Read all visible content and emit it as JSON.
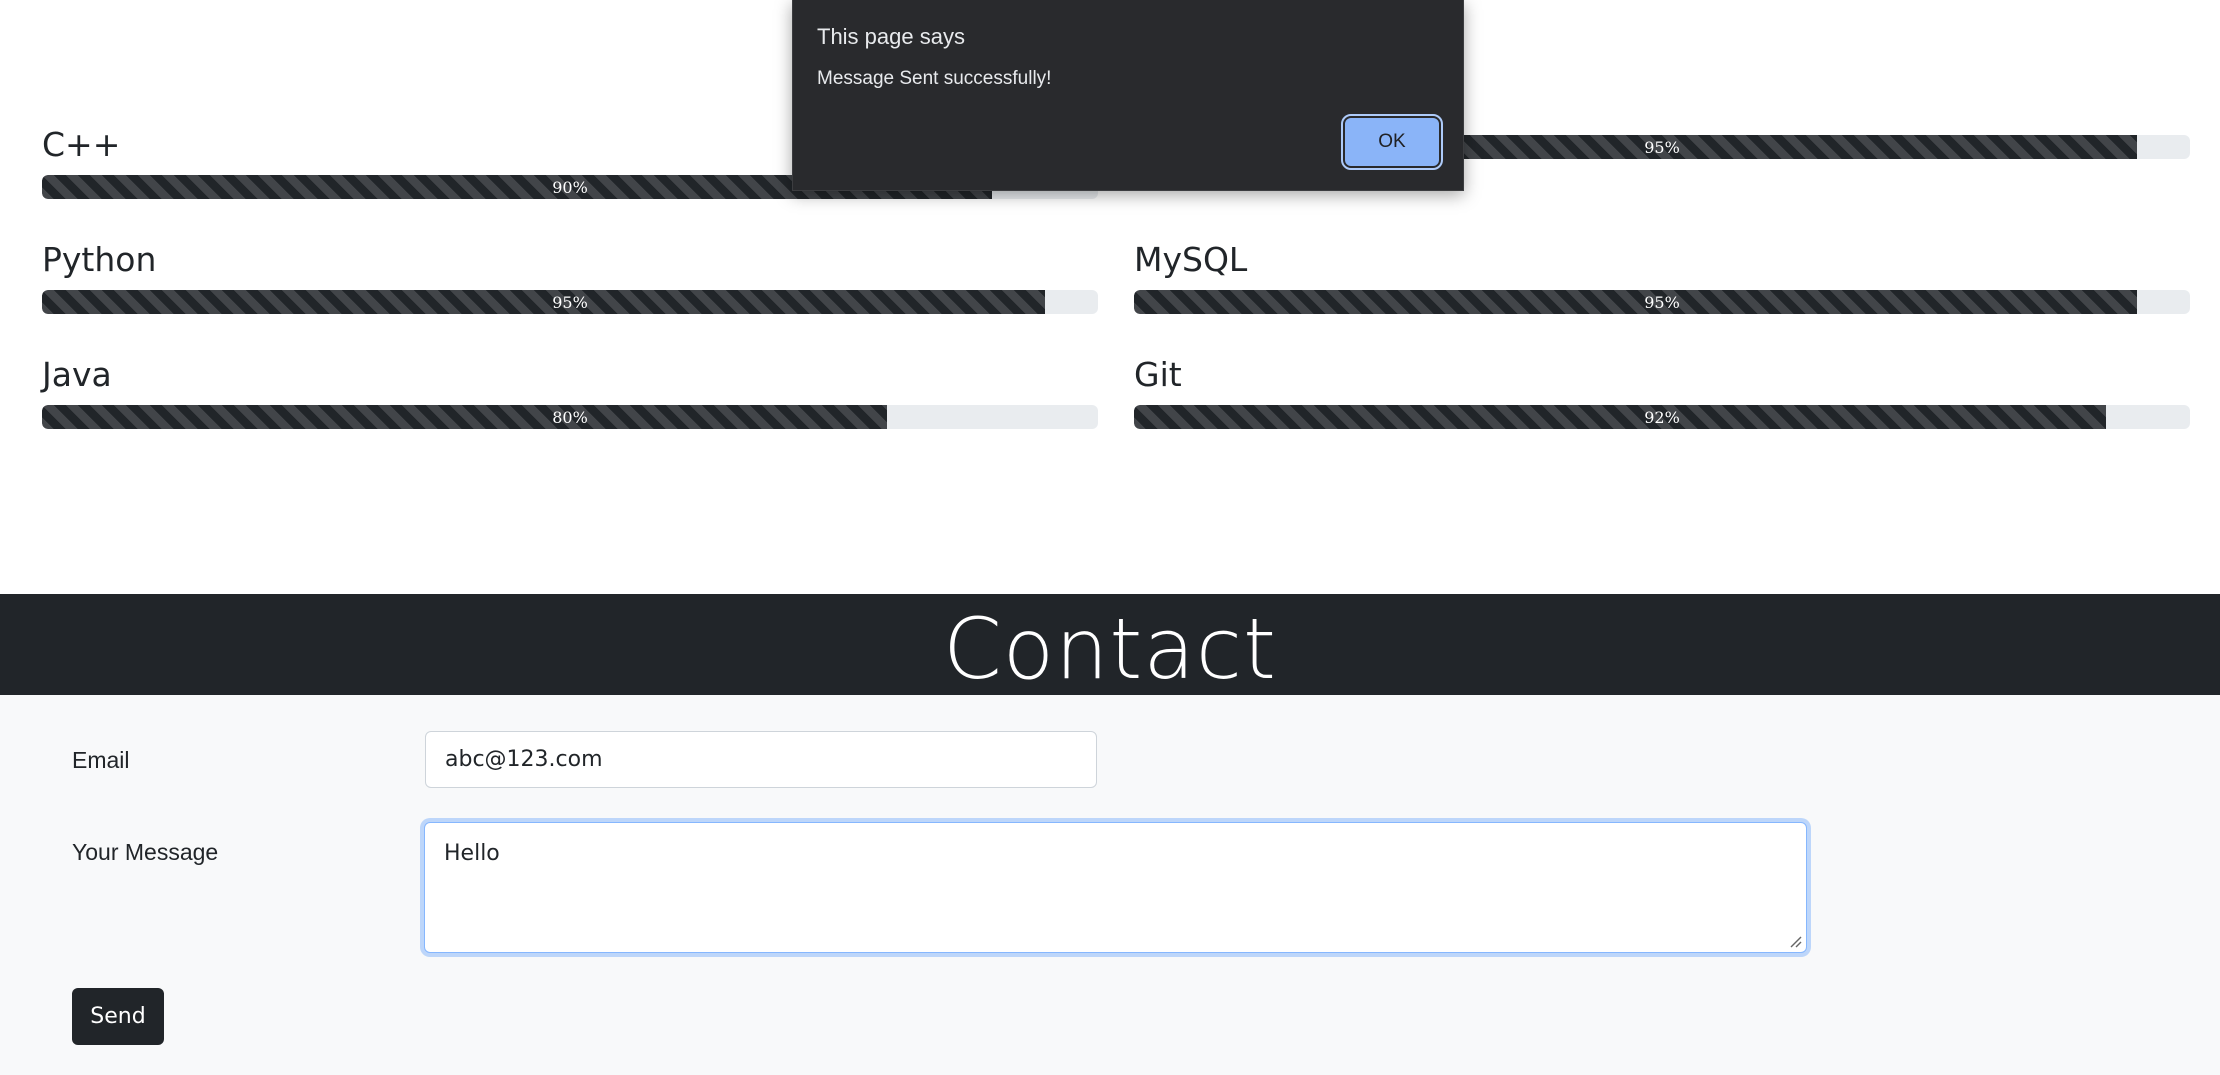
{
  "skills": [
    {
      "name": "C++",
      "percent": 90,
      "label": "90%"
    },
    {
      "name": "",
      "percent": 95,
      "label": "95%"
    },
    {
      "name": "Python",
      "percent": 95,
      "label": "95%"
    },
    {
      "name": "MySQL",
      "percent": 95,
      "label": "95%"
    },
    {
      "name": "Java",
      "percent": 80,
      "label": "80%"
    },
    {
      "name": "Git",
      "percent": 92,
      "label": "92%"
    }
  ],
  "contact": {
    "title": "Contact",
    "email_label": "Email",
    "email_value": "abc@123.com",
    "message_label": "Your Message",
    "message_value": "Hello",
    "send_label": "Send"
  },
  "alert": {
    "title": "This page says",
    "message": "Message Sent successfully!",
    "ok_label": "OK"
  },
  "colors": {
    "dark": "#212529",
    "track": "#e9ecef",
    "form_bg": "#f8f9fa",
    "dialog_bg": "#292a2d",
    "dialog_button": "#8ab4f8"
  }
}
